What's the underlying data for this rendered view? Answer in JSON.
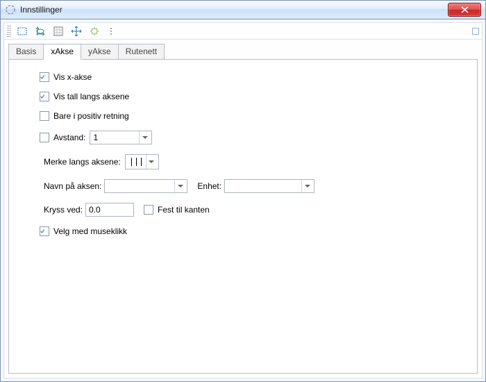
{
  "window": {
    "title": "Innstillinger"
  },
  "tabs": [
    {
      "label": "Basis"
    },
    {
      "label": "xAkse"
    },
    {
      "label": "yAkse"
    },
    {
      "label": "Rutenett"
    }
  ],
  "form": {
    "show_x_axis": {
      "label": "Vis x-akse",
      "checked": true
    },
    "show_numbers": {
      "label": "Vis tall langs aksene",
      "checked": true
    },
    "positive_only": {
      "label": "Bare i positiv retning",
      "checked": false
    },
    "distance": {
      "label": "Avstand:",
      "checked": false,
      "value": "1"
    },
    "tick_label": "Merke langs aksene:",
    "axis_name_label": "Navn på aksen:",
    "axis_name_value": "",
    "unit_label": "Enhet:",
    "unit_value": "",
    "cross_at_label": "Kryss ved:",
    "cross_at_value": "0.0",
    "stick_edge": {
      "label": "Fest til kanten",
      "checked": false
    },
    "select_click": {
      "label": "Velg med museklikk",
      "checked": true
    }
  }
}
